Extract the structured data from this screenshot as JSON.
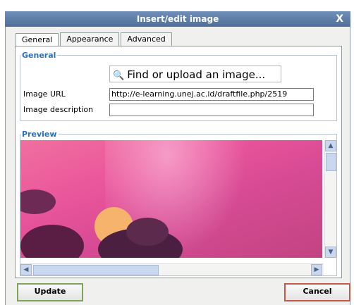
{
  "window": {
    "title": "Insert/edit image",
    "close_label": "X"
  },
  "tabs": [
    {
      "label": "General",
      "active": true
    },
    {
      "label": "Appearance",
      "active": false
    },
    {
      "label": "Advanced",
      "active": false
    }
  ],
  "general": {
    "legend": "General",
    "find_button_label": "Find or upload an image...",
    "image_url_label": "Image URL",
    "image_url_value": "http://e-learning.unej.ac.id/draftfile.php/2519",
    "image_description_label": "Image description",
    "image_description_value": ""
  },
  "preview": {
    "legend": "Preview",
    "scroll_up": "▲",
    "scroll_down": "▼",
    "scroll_left": "◀",
    "scroll_right": "▶"
  },
  "buttons": {
    "update": "Update",
    "cancel": "Cancel"
  },
  "colors": {
    "titlebar": "#5b7aa6",
    "legend": "#2b6fb6",
    "update_border": "#7fa35a",
    "cancel_border": "#c25a4a"
  },
  "icons": {
    "find": "magnifier-icon",
    "close": "close-icon"
  }
}
